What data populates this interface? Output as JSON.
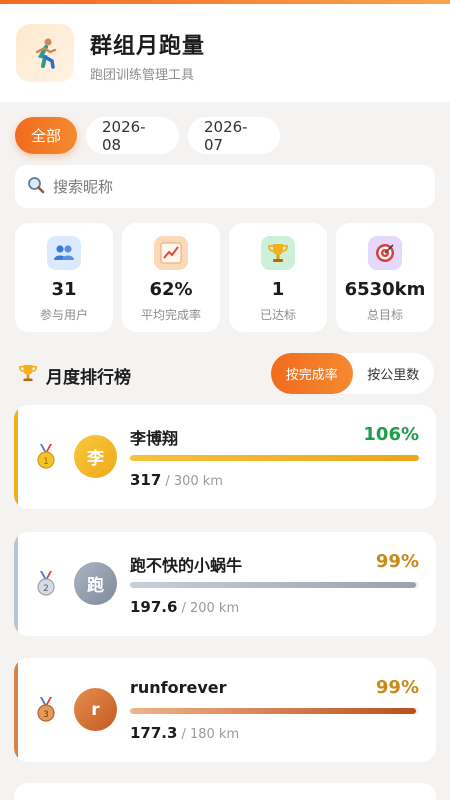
{
  "header": {
    "title": "群组月跑量",
    "subtitle": "跑团训练管理工具",
    "logo_icon": "runner-icon",
    "accent": "#f26b1d"
  },
  "months": [
    {
      "label": "全部",
      "active": true
    },
    {
      "label": "2026-08",
      "active": false
    },
    {
      "label": "2026-07",
      "active": false
    }
  ],
  "search": {
    "placeholder": "搜索昵称",
    "value": ""
  },
  "stats": [
    {
      "icon": "users-icon",
      "value": "31",
      "label": "参与用户"
    },
    {
      "icon": "chart-icon",
      "value": "62%",
      "label": "平均完成率"
    },
    {
      "icon": "trophy-icon",
      "value": "1",
      "label": "已达标"
    },
    {
      "icon": "target-icon",
      "value": "6530km",
      "label": "总目标"
    }
  ],
  "ranking": {
    "title": "月度排行榜",
    "sort_options": [
      {
        "label": "按完成率",
        "active": true
      },
      {
        "label": "按公里数",
        "active": false
      }
    ],
    "entries": [
      {
        "rank": 1,
        "medal": "gold-medal-icon",
        "avatar_text": "李",
        "name": "李博翔",
        "percent_text": "106%",
        "distance": "317",
        "target": "/ 300 km",
        "progress": 1.0,
        "color": "#f0ae1c",
        "pct_color": "#1e9d4c"
      },
      {
        "rank": 2,
        "medal": "silver-medal-icon",
        "avatar_text": "跑",
        "name": "跑不快的小蜗牛",
        "percent_text": "99%",
        "distance": "197.6",
        "target": "/ 200 km",
        "progress": 0.99,
        "color": "#9aa3b0",
        "pct_color": "#c98a1a"
      },
      {
        "rank": 3,
        "medal": "bronze-medal-icon",
        "avatar_text": "r",
        "name": "runforever",
        "percent_text": "99%",
        "distance": "177.3",
        "target": "/ 180 km",
        "progress": 0.99,
        "color": "#c8642a",
        "pct_color": "#c98a1a"
      }
    ]
  }
}
